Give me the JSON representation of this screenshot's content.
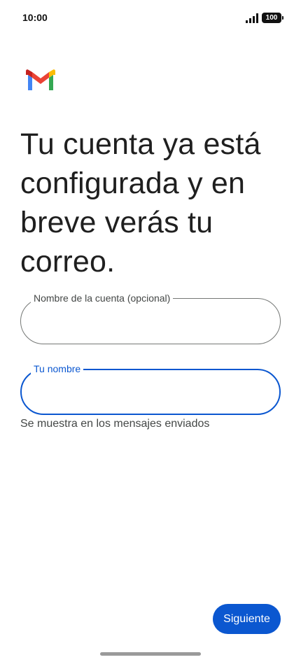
{
  "status_bar": {
    "time": "10:00",
    "battery": "100",
    "signal_icon": "signal-bars-icon"
  },
  "app": {
    "logo_icon": "gmail-logo-icon",
    "brand_colors": {
      "blue": "#4285f4",
      "red": "#ea4335",
      "yellow": "#fbbc04",
      "green": "#34a853"
    }
  },
  "headline": "Tu cuenta ya está configurada y en breve verás tu correo.",
  "fields": {
    "account_name": {
      "label": "Nombre de la cuenta (opcional)",
      "value": ""
    },
    "your_name": {
      "label": "Tu nombre",
      "value": "",
      "helper": "Se muestra en los mensajes enviados"
    }
  },
  "next_button": {
    "label": "Siguiente",
    "color": "#0b57d0"
  },
  "accent_color": "#0b57d0"
}
